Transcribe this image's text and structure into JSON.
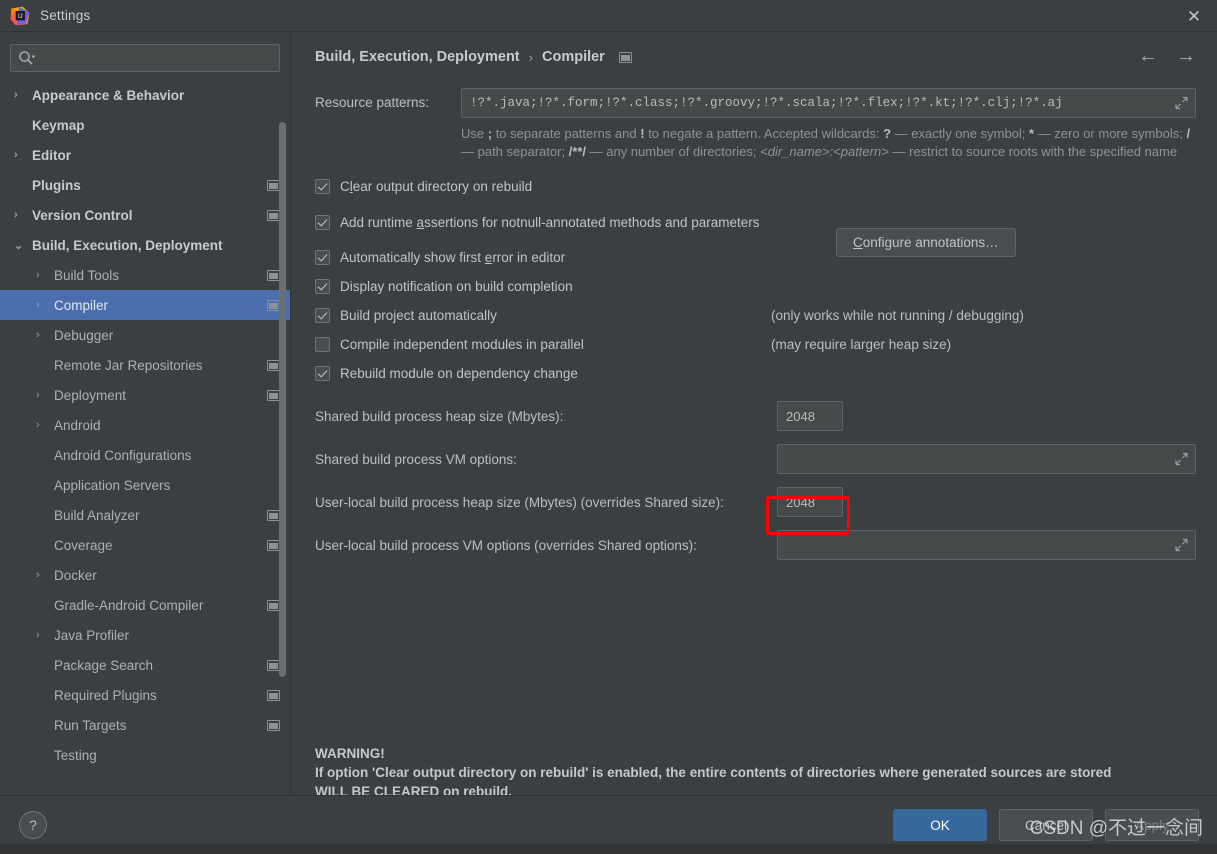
{
  "window": {
    "title": "Settings",
    "logo_icon": "intellij-idea-logo",
    "close_icon": "close-icon"
  },
  "search": {
    "placeholder": "",
    "value": "",
    "icon": "search-icon"
  },
  "sidebar": {
    "items": [
      {
        "label": "Appearance & Behavior",
        "level": 0,
        "bold": true,
        "arrow": "›",
        "badge": false,
        "selected": false
      },
      {
        "label": "Keymap",
        "level": 0,
        "bold": true,
        "arrow": "",
        "badge": false,
        "selected": false
      },
      {
        "label": "Editor",
        "level": 0,
        "bold": true,
        "arrow": "›",
        "badge": false,
        "selected": false
      },
      {
        "label": "Plugins",
        "level": 0,
        "bold": true,
        "arrow": "",
        "badge": true,
        "selected": false
      },
      {
        "label": "Version Control",
        "level": 0,
        "bold": true,
        "arrow": "›",
        "badge": true,
        "selected": false
      },
      {
        "label": "Build, Execution, Deployment",
        "level": 0,
        "bold": true,
        "arrow": "⌄",
        "badge": false,
        "selected": false
      },
      {
        "label": "Build Tools",
        "level": 1,
        "bold": false,
        "arrow": "›",
        "badge": true,
        "selected": false
      },
      {
        "label": "Compiler",
        "level": 1,
        "bold": false,
        "arrow": "›",
        "badge": true,
        "selected": true
      },
      {
        "label": "Debugger",
        "level": 1,
        "bold": false,
        "arrow": "›",
        "badge": false,
        "selected": false
      },
      {
        "label": "Remote Jar Repositories",
        "level": 1,
        "bold": false,
        "arrow": "",
        "badge": true,
        "selected": false
      },
      {
        "label": "Deployment",
        "level": 1,
        "bold": false,
        "arrow": "›",
        "badge": true,
        "selected": false
      },
      {
        "label": "Android",
        "level": 1,
        "bold": false,
        "arrow": "›",
        "badge": false,
        "selected": false
      },
      {
        "label": "Android Configurations",
        "level": 1,
        "bold": false,
        "arrow": "",
        "badge": false,
        "selected": false
      },
      {
        "label": "Application Servers",
        "level": 1,
        "bold": false,
        "arrow": "",
        "badge": false,
        "selected": false
      },
      {
        "label": "Build Analyzer",
        "level": 1,
        "bold": false,
        "arrow": "",
        "badge": true,
        "selected": false
      },
      {
        "label": "Coverage",
        "level": 1,
        "bold": false,
        "arrow": "",
        "badge": true,
        "selected": false
      },
      {
        "label": "Docker",
        "level": 1,
        "bold": false,
        "arrow": "›",
        "badge": false,
        "selected": false
      },
      {
        "label": "Gradle-Android Compiler",
        "level": 1,
        "bold": false,
        "arrow": "",
        "badge": true,
        "selected": false
      },
      {
        "label": "Java Profiler",
        "level": 1,
        "bold": false,
        "arrow": "›",
        "badge": false,
        "selected": false
      },
      {
        "label": "Package Search",
        "level": 1,
        "bold": false,
        "arrow": "",
        "badge": true,
        "selected": false
      },
      {
        "label": "Required Plugins",
        "level": 1,
        "bold": false,
        "arrow": "",
        "badge": true,
        "selected": false
      },
      {
        "label": "Run Targets",
        "level": 1,
        "bold": false,
        "arrow": "",
        "badge": true,
        "selected": false
      },
      {
        "label": "Testing",
        "level": 1,
        "bold": false,
        "arrow": "",
        "badge": false,
        "selected": false
      }
    ]
  },
  "header": {
    "breadcrumb_root": "Build, Execution, Deployment",
    "breadcrumb_sep": "›",
    "breadcrumb_leaf": "Compiler",
    "scope_icon": "project-setting-badge-icon",
    "back_icon": "←",
    "forward_icon": "→"
  },
  "main": {
    "resource_patterns": {
      "label": "Resource patterns:",
      "value": "!?*.java;!?*.form;!?*.class;!?*.groovy;!?*.scala;!?*.flex;!?*.kt;!?*.clj;!?*.aj",
      "expand_icon": "expand-icon"
    },
    "hint": {
      "p1": "Use ",
      "b1": ";",
      "p2": " to separate patterns and ",
      "b2": "!",
      "p3": " to negate a pattern. Accepted wildcards: ",
      "b3": "?",
      "p4": " — exactly one symbol; ",
      "b4": "*",
      "p5": " — zero or more symbols; ",
      "b5": "/",
      "p6": " — path separator; ",
      "b6": "/**/",
      "p7": " — any number of directories; ",
      "i1": "<dir_name>:<pattern>",
      "p8": " — restrict to source roots with the specified name"
    },
    "checkboxes": [
      {
        "label_pre": "C",
        "label_mn": "l",
        "label_post": "ear output directory on rebuild",
        "checked": true,
        "note": ""
      },
      {
        "label_pre": "Add runtime ",
        "label_mn": "a",
        "label_post": "ssertions for notnull-annotated methods and parameters",
        "checked": true,
        "note": ""
      },
      {
        "label_pre": "Automatically show first ",
        "label_mn": "e",
        "label_post": "rror in editor",
        "checked": true,
        "note": ""
      },
      {
        "label_pre": "Display notification on build completion",
        "label_mn": "",
        "label_post": "",
        "checked": true,
        "note": ""
      },
      {
        "label_pre": "Build project automatically",
        "label_mn": "",
        "label_post": "",
        "checked": true,
        "note": "(only works while not running / debugging)"
      },
      {
        "label_pre": "Compile independent modules in parallel",
        "label_mn": "",
        "label_post": "",
        "checked": false,
        "note": "(may require larger heap size)"
      },
      {
        "label_pre": "Rebuild module on dependency change",
        "label_mn": "",
        "label_post": "",
        "checked": true,
        "note": ""
      }
    ],
    "configure_annotations": {
      "pre": "",
      "mn": "C",
      "post": "onfigure annotations…"
    },
    "shared_heap": {
      "label": "Shared build process heap size (Mbytes):",
      "value": "2048"
    },
    "shared_vm": {
      "label": "Shared build process VM options:",
      "value": "",
      "expand_icon": "expand-icon"
    },
    "user_heap": {
      "label": "User-local build process heap size (Mbytes) (overrides Shared size):",
      "value": "2048"
    },
    "user_vm": {
      "label": "User-local build process VM options (overrides Shared options):",
      "value": "",
      "expand_icon": "expand-icon"
    },
    "warning": {
      "line1": "WARNING!",
      "line2": "If option 'Clear output directory on rebuild' is enabled, the entire contents of directories where generated sources are stored",
      "line3": "WILL BE CLEARED on rebuild."
    }
  },
  "footer": {
    "help_label": "?",
    "ok_label": "OK",
    "cancel_label": "Cancel",
    "apply_label": "Apply"
  },
  "annotation": {
    "color": "#fe0000",
    "target": "user-local-heap-size-input"
  },
  "watermark": {
    "text": "CSDN @不过一念间"
  }
}
